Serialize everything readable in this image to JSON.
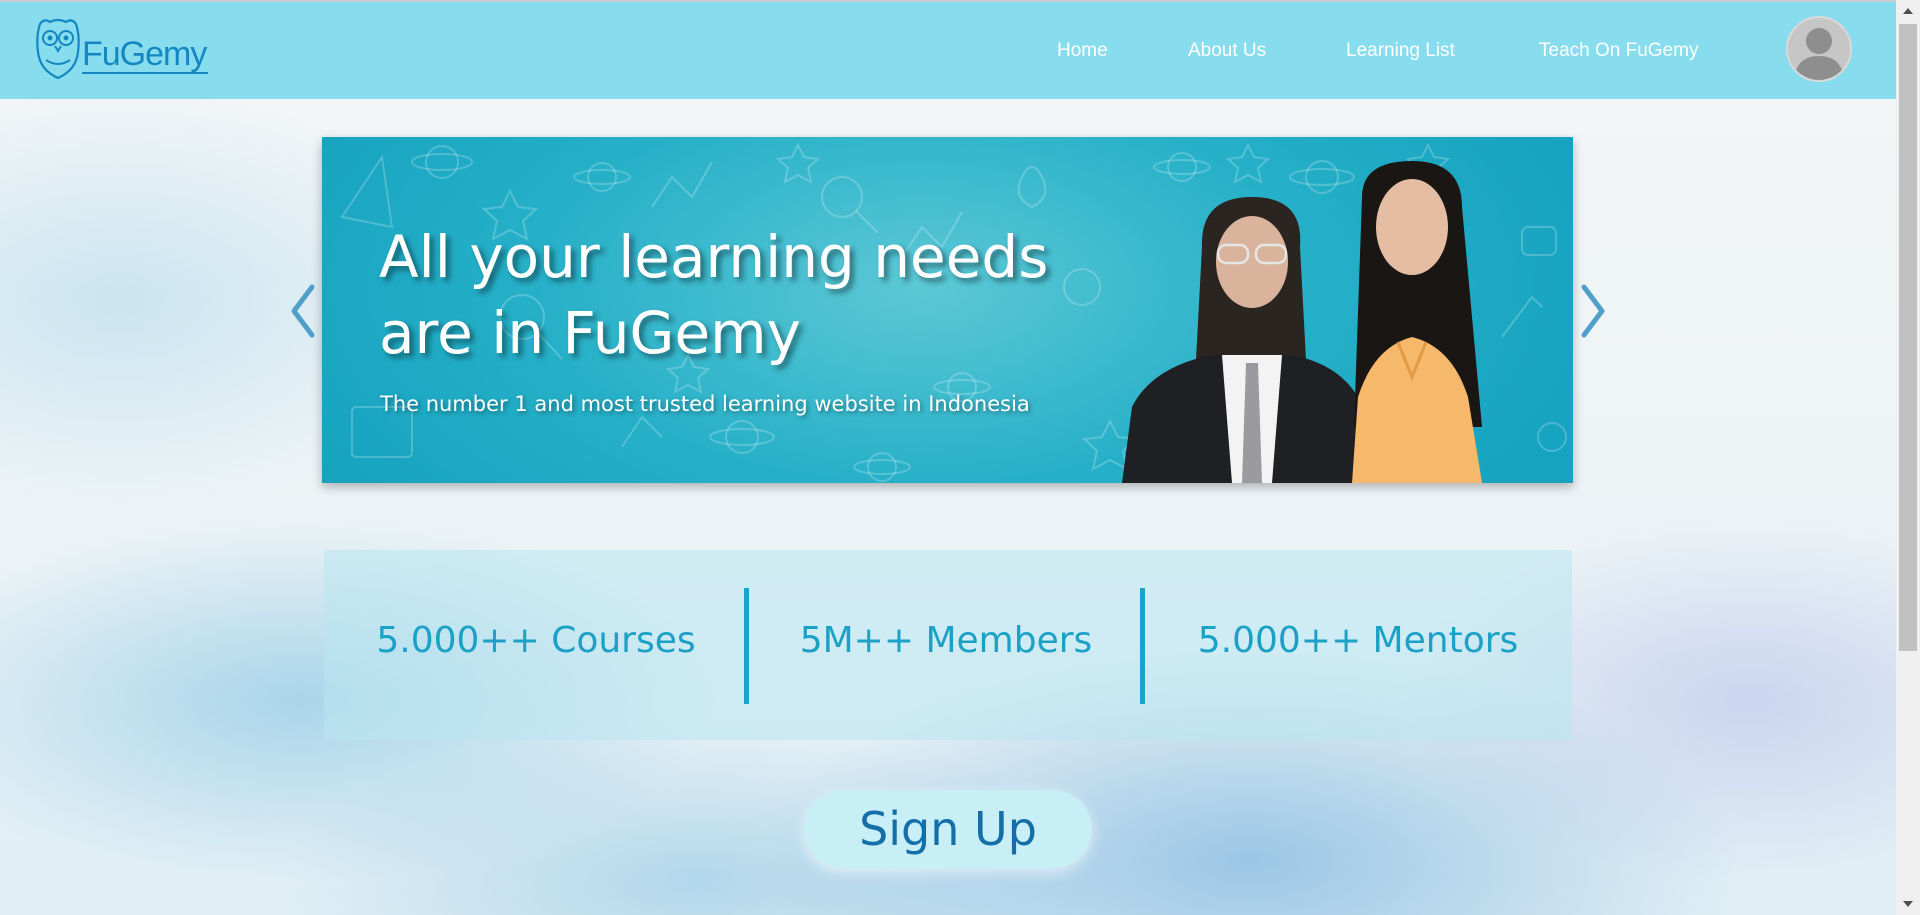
{
  "brand": {
    "name": "FuGemy",
    "logo_icon": "owl-icon"
  },
  "nav": {
    "items": [
      {
        "label": "Home"
      },
      {
        "label": "About Us"
      },
      {
        "label": "Learning List"
      },
      {
        "label": "Teach On FuGemy"
      }
    ],
    "avatar_icon": "user-avatar-icon"
  },
  "banner": {
    "title_line1": "All your learning needs",
    "title_line2": "are in FuGemy",
    "subtitle": "The number 1 and most trusted learning website in Indonesia",
    "prev_icon": "chevron-left-icon",
    "next_icon": "chevron-right-icon"
  },
  "stats": [
    {
      "label": "5.000++ Courses"
    },
    {
      "label": "5M++ Members"
    },
    {
      "label": "5.000++ Mentors"
    }
  ],
  "signup": {
    "label": "Sign Up"
  },
  "colors": {
    "header_bg": "#87dded",
    "brand_blue": "#1487c2",
    "banner_teal": "#26b0c8",
    "stat_text": "#1ba1c6",
    "signup_text": "#146fa8"
  }
}
